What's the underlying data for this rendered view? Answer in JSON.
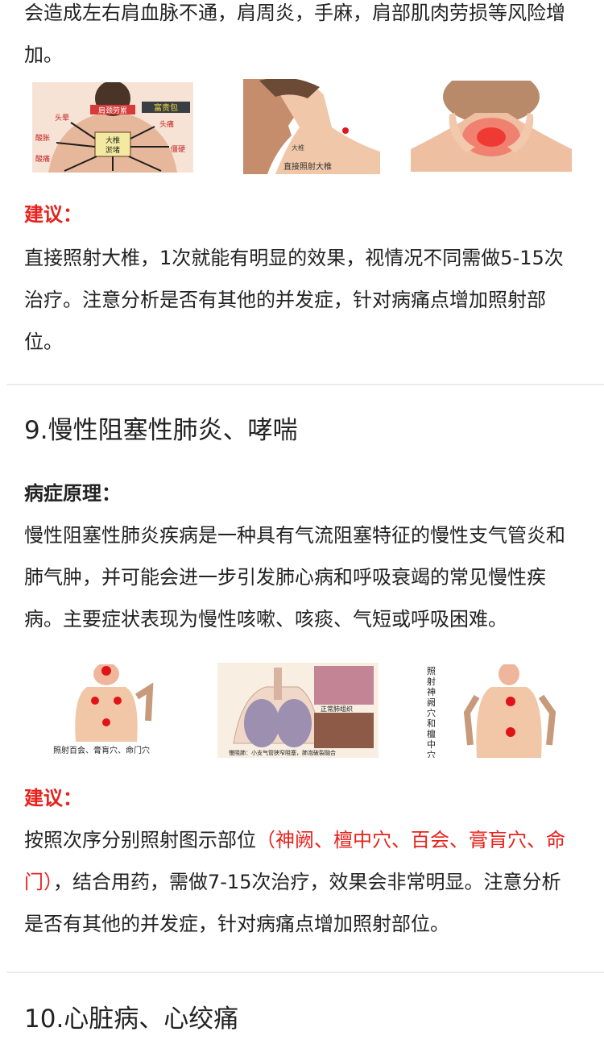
{
  "top": {
    "text_line1": "会造成左右肩血脉不通，肩周炎，手麻，肩部肌肉劳损等风险增",
    "text_line2": "加。",
    "img1_labels": {
      "top_left": "肩颈劳累",
      "top_right": "富贵包",
      "l1": "头晕",
      "r1": "头痛",
      "l2": "酸胀",
      "r2": "僵硬",
      "l3": "酸痛",
      "box": "大椎\n淤堵"
    },
    "img2_caption": "直接照射大椎",
    "img2_mark": "大椎",
    "suggest_label": "建议：",
    "suggest_text": "直接照射大椎，1次就能有明显的效果，视情况不同需做5-15次治疗。注意分析是否有其他的并发症，针对病痛点增加照射部位。"
  },
  "section9": {
    "title": "9.慢性阻塞性肺炎、哮喘",
    "principle_label": "病症原理：",
    "principle_text": "慢性阻塞性肺炎疾病是一种具有气流阻塞特征的慢性支气管炎和肺气肿，并可能会进一步引发肺心病和呼吸衰竭的常见慢性疾病。主要症状表现为慢性咳嗽、咳痰、气短或呼吸困难。",
    "img1_caption": "照射百会、膏肓穴、命门穴",
    "img2_caption": "慢阻肺：小支气管狭窄阻塞，肺泡破裂融合",
    "img2_label": "正常肺组织",
    "img3_caption": "照射神阙穴和檀中穴",
    "suggest_label": "建议：",
    "suggest_pre": "按照次序分别照射图示部位",
    "suggest_red": "（神阙、檀中穴、百会、膏肓穴、命门）",
    "suggest_post": "，结合用药，需做7-15次治疗，效果会非常明显。注意分析是否有其他的并发症，针对病痛点增加照射部位。"
  },
  "section10": {
    "title": "10.心脏病、心绞痛"
  },
  "colors": {
    "accent_red": "#e8211b",
    "text": "#222222",
    "divider": "#ececec"
  }
}
